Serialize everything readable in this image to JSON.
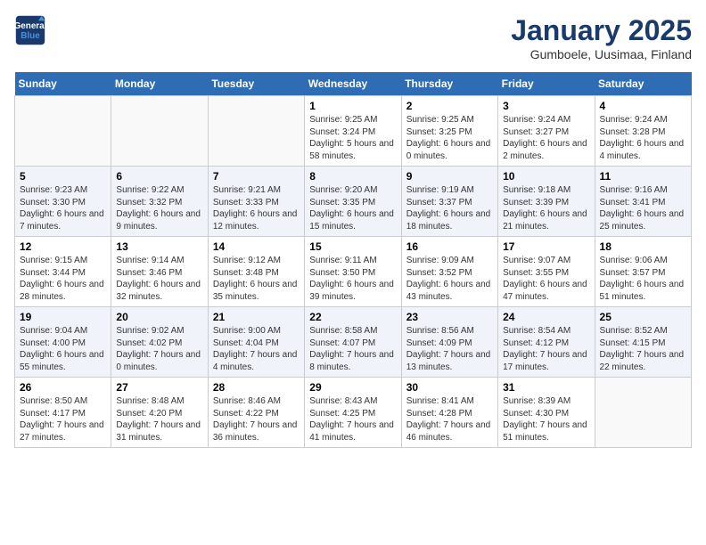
{
  "header": {
    "logo_line1": "General",
    "logo_line2": "Blue",
    "title": "January 2025",
    "subtitle": "Gumboele, Uusimaa, Finland"
  },
  "days_of_week": [
    "Sunday",
    "Monday",
    "Tuesday",
    "Wednesday",
    "Thursday",
    "Friday",
    "Saturday"
  ],
  "weeks": [
    [
      {
        "day": "",
        "info": ""
      },
      {
        "day": "",
        "info": ""
      },
      {
        "day": "",
        "info": ""
      },
      {
        "day": "1",
        "info": "Sunrise: 9:25 AM\nSunset: 3:24 PM\nDaylight: 5 hours and 58 minutes."
      },
      {
        "day": "2",
        "info": "Sunrise: 9:25 AM\nSunset: 3:25 PM\nDaylight: 6 hours and 0 minutes."
      },
      {
        "day": "3",
        "info": "Sunrise: 9:24 AM\nSunset: 3:27 PM\nDaylight: 6 hours and 2 minutes."
      },
      {
        "day": "4",
        "info": "Sunrise: 9:24 AM\nSunset: 3:28 PM\nDaylight: 6 hours and 4 minutes."
      }
    ],
    [
      {
        "day": "5",
        "info": "Sunrise: 9:23 AM\nSunset: 3:30 PM\nDaylight: 6 hours and 7 minutes."
      },
      {
        "day": "6",
        "info": "Sunrise: 9:22 AM\nSunset: 3:32 PM\nDaylight: 6 hours and 9 minutes."
      },
      {
        "day": "7",
        "info": "Sunrise: 9:21 AM\nSunset: 3:33 PM\nDaylight: 6 hours and 12 minutes."
      },
      {
        "day": "8",
        "info": "Sunrise: 9:20 AM\nSunset: 3:35 PM\nDaylight: 6 hours and 15 minutes."
      },
      {
        "day": "9",
        "info": "Sunrise: 9:19 AM\nSunset: 3:37 PM\nDaylight: 6 hours and 18 minutes."
      },
      {
        "day": "10",
        "info": "Sunrise: 9:18 AM\nSunset: 3:39 PM\nDaylight: 6 hours and 21 minutes."
      },
      {
        "day": "11",
        "info": "Sunrise: 9:16 AM\nSunset: 3:41 PM\nDaylight: 6 hours and 25 minutes."
      }
    ],
    [
      {
        "day": "12",
        "info": "Sunrise: 9:15 AM\nSunset: 3:44 PM\nDaylight: 6 hours and 28 minutes."
      },
      {
        "day": "13",
        "info": "Sunrise: 9:14 AM\nSunset: 3:46 PM\nDaylight: 6 hours and 32 minutes."
      },
      {
        "day": "14",
        "info": "Sunrise: 9:12 AM\nSunset: 3:48 PM\nDaylight: 6 hours and 35 minutes."
      },
      {
        "day": "15",
        "info": "Sunrise: 9:11 AM\nSunset: 3:50 PM\nDaylight: 6 hours and 39 minutes."
      },
      {
        "day": "16",
        "info": "Sunrise: 9:09 AM\nSunset: 3:52 PM\nDaylight: 6 hours and 43 minutes."
      },
      {
        "day": "17",
        "info": "Sunrise: 9:07 AM\nSunset: 3:55 PM\nDaylight: 6 hours and 47 minutes."
      },
      {
        "day": "18",
        "info": "Sunrise: 9:06 AM\nSunset: 3:57 PM\nDaylight: 6 hours and 51 minutes."
      }
    ],
    [
      {
        "day": "19",
        "info": "Sunrise: 9:04 AM\nSunset: 4:00 PM\nDaylight: 6 hours and 55 minutes."
      },
      {
        "day": "20",
        "info": "Sunrise: 9:02 AM\nSunset: 4:02 PM\nDaylight: 7 hours and 0 minutes."
      },
      {
        "day": "21",
        "info": "Sunrise: 9:00 AM\nSunset: 4:04 PM\nDaylight: 7 hours and 4 minutes."
      },
      {
        "day": "22",
        "info": "Sunrise: 8:58 AM\nSunset: 4:07 PM\nDaylight: 7 hours and 8 minutes."
      },
      {
        "day": "23",
        "info": "Sunrise: 8:56 AM\nSunset: 4:09 PM\nDaylight: 7 hours and 13 minutes."
      },
      {
        "day": "24",
        "info": "Sunrise: 8:54 AM\nSunset: 4:12 PM\nDaylight: 7 hours and 17 minutes."
      },
      {
        "day": "25",
        "info": "Sunrise: 8:52 AM\nSunset: 4:15 PM\nDaylight: 7 hours and 22 minutes."
      }
    ],
    [
      {
        "day": "26",
        "info": "Sunrise: 8:50 AM\nSunset: 4:17 PM\nDaylight: 7 hours and 27 minutes."
      },
      {
        "day": "27",
        "info": "Sunrise: 8:48 AM\nSunset: 4:20 PM\nDaylight: 7 hours and 31 minutes."
      },
      {
        "day": "28",
        "info": "Sunrise: 8:46 AM\nSunset: 4:22 PM\nDaylight: 7 hours and 36 minutes."
      },
      {
        "day": "29",
        "info": "Sunrise: 8:43 AM\nSunset: 4:25 PM\nDaylight: 7 hours and 41 minutes."
      },
      {
        "day": "30",
        "info": "Sunrise: 8:41 AM\nSunset: 4:28 PM\nDaylight: 7 hours and 46 minutes."
      },
      {
        "day": "31",
        "info": "Sunrise: 8:39 AM\nSunset: 4:30 PM\nDaylight: 7 hours and 51 minutes."
      },
      {
        "day": "",
        "info": ""
      }
    ]
  ]
}
